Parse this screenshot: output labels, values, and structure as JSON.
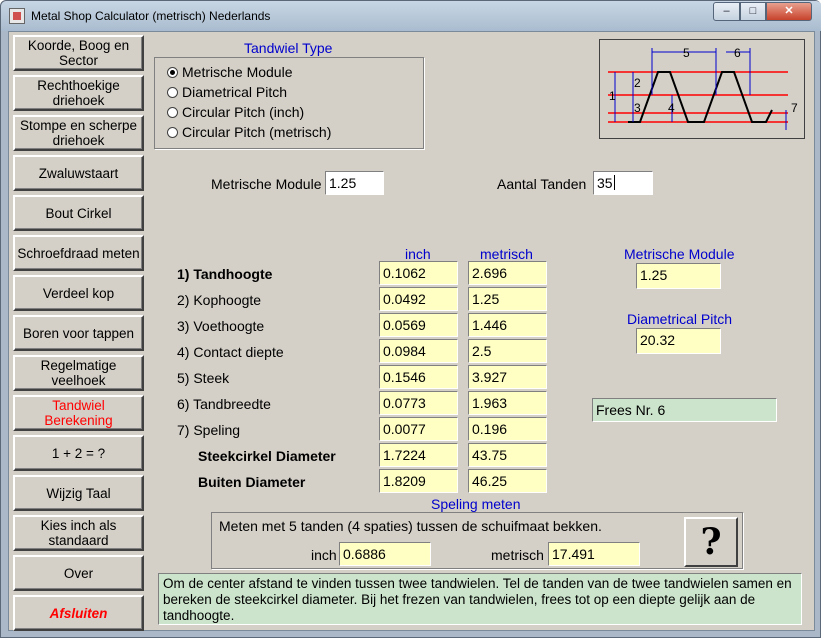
{
  "window": {
    "title": "Metal Shop Calculator (metrisch) Nederlands",
    "minimize": "–",
    "maximize": "□",
    "close": "✕"
  },
  "sidebar": {
    "items": [
      {
        "label": "Koorde, Boog en Sector"
      },
      {
        "label": "Rechthoekige driehoek"
      },
      {
        "label": "Stompe en scherpe driehoek"
      },
      {
        "label": "Zwaluwstaart"
      },
      {
        "label": "Bout Cirkel"
      },
      {
        "label": "Schroefdraad meten"
      },
      {
        "label": "Verdeel kop"
      },
      {
        "label": "Boren voor tappen"
      },
      {
        "label": "Regelmatige veelhoek"
      },
      {
        "label": "Tandwiel Berekening"
      },
      {
        "label": "1 + 2 = ?"
      },
      {
        "label": "Wijzig Taal"
      },
      {
        "label": "Kies inch als standaard"
      },
      {
        "label": "Over"
      },
      {
        "label": "Afsluiten"
      }
    ],
    "active_index": 9,
    "active_color": "#ff0000"
  },
  "gear_type": {
    "title": "Tandwiel Type",
    "options": [
      {
        "label": "Metrische Module",
        "selected": true
      },
      {
        "label": "Diametrical Pitch",
        "selected": false
      },
      {
        "label": "Circular Pitch (inch)",
        "selected": false
      },
      {
        "label": "Circular Pitch (metrisch)",
        "selected": false
      }
    ]
  },
  "diagram": {
    "labels": [
      "5",
      "6",
      "1",
      "2",
      "3",
      "4",
      "7"
    ]
  },
  "inputs": {
    "module_label": "Metrische Module",
    "module_value": "1.25",
    "teeth_label": "Aantal Tanden",
    "teeth_value": "35"
  },
  "results": {
    "col_inch": "inch",
    "col_metric": "metrisch",
    "rows": [
      {
        "label": "1) Tandhoogte",
        "inch": "0.1062",
        "metric": "2.696"
      },
      {
        "label": "2) Kophoogte",
        "inch": "0.0492",
        "metric": "1.25"
      },
      {
        "label": "3) Voethoogte",
        "inch": "0.0569",
        "metric": "1.446"
      },
      {
        "label": "4) Contact diepte",
        "inch": "0.0984",
        "metric": "2.5"
      },
      {
        "label": "5) Steek",
        "inch": "0.1546",
        "metric": "3.927"
      },
      {
        "label": "6) Tandbreedte",
        "inch": "0.0773",
        "metric": "1.963"
      },
      {
        "label": "7) Speling",
        "inch": "0.0077",
        "metric": "0.196"
      },
      {
        "label": "Steekcirkel Diameter",
        "inch": "1.7224",
        "metric": "43.75"
      },
      {
        "label": "Buiten Diameter",
        "inch": "1.8209",
        "metric": "46.25"
      }
    ]
  },
  "side_values": {
    "module_title": "Metrische Module",
    "module_value": "1.25",
    "dp_title": "Diametrical Pitch",
    "dp_value": "20.32",
    "cutter": "Frees Nr. 6"
  },
  "speling": {
    "title": "Speling meten",
    "text": "Meten met 5 tanden (4 spaties) tussen de schuifmaat bekken.",
    "inch_label": "inch",
    "inch_value": "0.6886",
    "metric_label": "metrisch",
    "metric_value": "17.491",
    "help": "?"
  },
  "info": "Om de center afstand te vinden tussen twee tandwielen. Tel de tanden van de twee tandwielen samen en bereken de steekcirkel diameter. Bij het frezen van tandwielen, frees tot op een diepte gelijk aan de tandhoogte.",
  "colors": {
    "accent_blue": "#0000cc",
    "result_bg": "#ffffc4",
    "info_bg": "#cce4cc",
    "face": "#d4d0c8"
  }
}
